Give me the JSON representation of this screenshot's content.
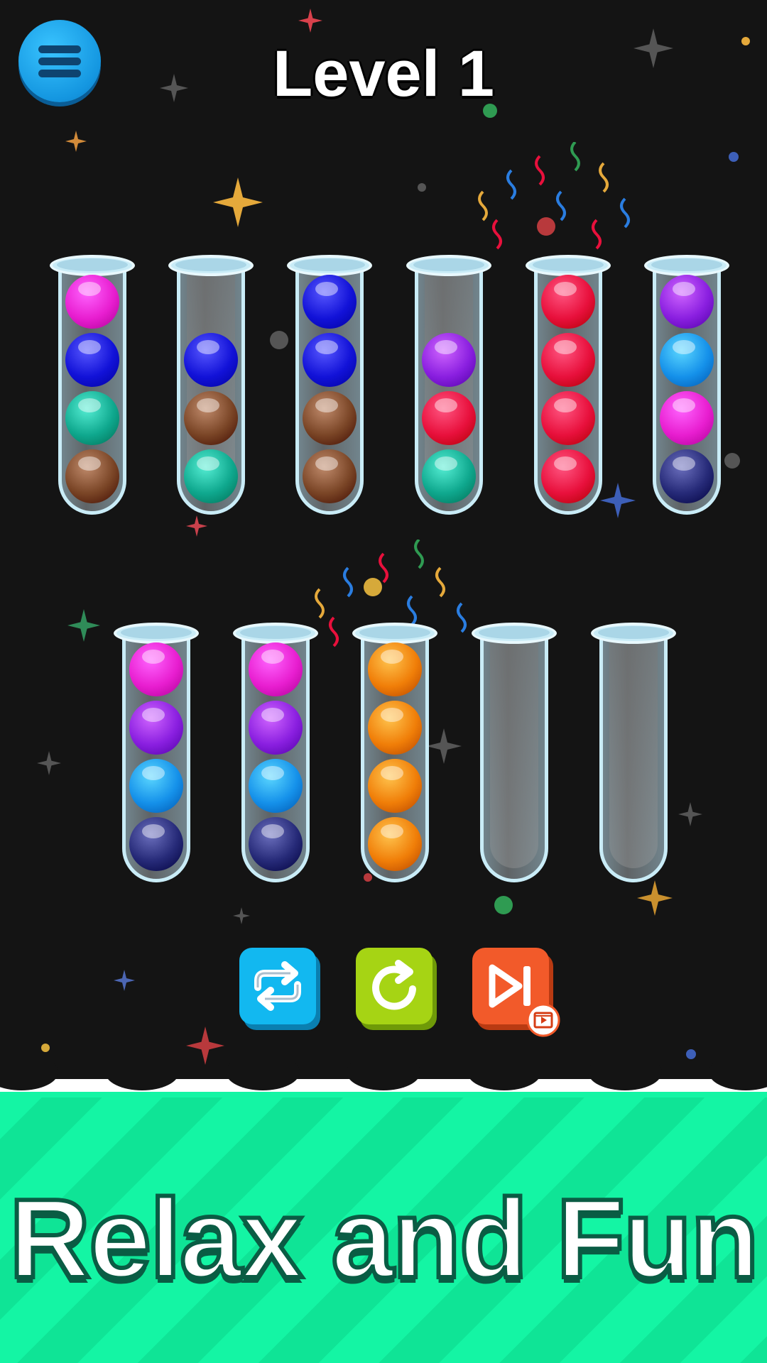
{
  "header": {
    "level_title": "Level 1",
    "menu_icon": "hamburger-icon"
  },
  "colors": {
    "magenta": "#e81ed0",
    "blue": "#1212d8",
    "teal": "#0fa88e",
    "brown": "#7a4526",
    "purple": "#8a1fe0",
    "red": "#e8103c",
    "skyblue": "#1591ea",
    "navy": "#262a78",
    "orange": "#f07e08"
  },
  "tubes": [
    {
      "id": 1,
      "balls": [
        "magenta",
        "blue",
        "teal",
        "brown"
      ]
    },
    {
      "id": 2,
      "balls": [
        "blue",
        "brown",
        "teal"
      ]
    },
    {
      "id": 3,
      "balls": [
        "blue",
        "blue",
        "brown",
        "brown"
      ]
    },
    {
      "id": 4,
      "balls": [
        "purple",
        "red",
        "teal"
      ]
    },
    {
      "id": 5,
      "balls": [
        "red",
        "red",
        "red",
        "red"
      ]
    },
    {
      "id": 6,
      "balls": [
        "purple",
        "skyblue",
        "magenta",
        "navy"
      ]
    },
    {
      "id": 7,
      "balls": [
        "magenta",
        "purple",
        "skyblue",
        "navy"
      ]
    },
    {
      "id": 8,
      "balls": [
        "magenta",
        "purple",
        "skyblue",
        "navy"
      ]
    },
    {
      "id": 9,
      "balls": [
        "orange",
        "orange",
        "orange",
        "orange"
      ]
    },
    {
      "id": 10,
      "balls": []
    },
    {
      "id": 11,
      "balls": []
    }
  ],
  "controls": [
    {
      "name": "swap-button",
      "icon": "repeat-arrows-icon",
      "color": "#12b8f0",
      "shade": "#0a7fb0"
    },
    {
      "name": "restart-button",
      "icon": "rotate-arrow-icon",
      "color": "#a6d414",
      "shade": "#6f9a08"
    },
    {
      "name": "skip-level-button",
      "icon": "skip-forward-icon",
      "color": "#f25a2a",
      "shade": "#b93a12",
      "badge_icon": "video-ad-icon"
    }
  ],
  "banner": {
    "slogan": "Relax and Fun"
  }
}
